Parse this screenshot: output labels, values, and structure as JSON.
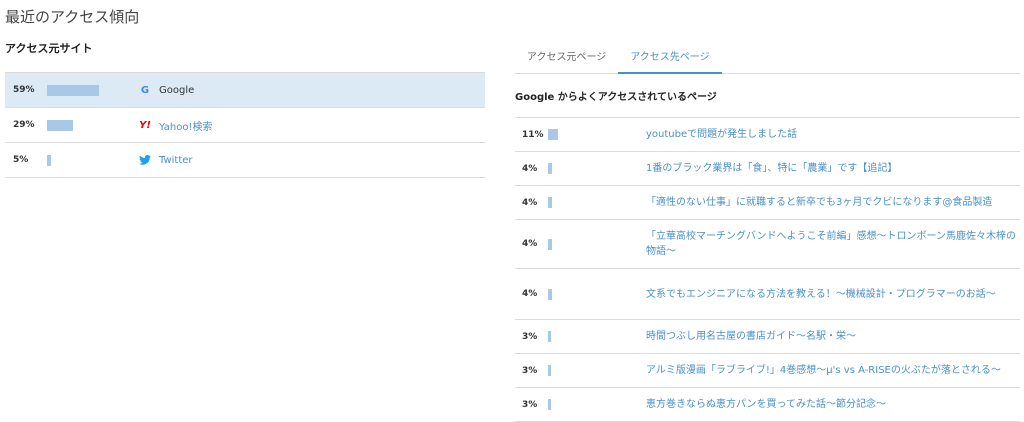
{
  "page_title": "最近のアクセス傾向",
  "sources": {
    "title": "アクセス元サイト",
    "items": [
      {
        "percent": "59%",
        "share": 0.59,
        "name": "Google",
        "icon": "google-icon",
        "selected": true
      },
      {
        "percent": "29%",
        "share": 0.29,
        "name": "Yahoo!検索",
        "icon": "yahoo-icon",
        "selected": false
      },
      {
        "percent": "5%",
        "share": 0.05,
        "name": "Twitter",
        "icon": "twitter-icon",
        "selected": false
      }
    ]
  },
  "tabs": [
    {
      "label": "アクセス元ページ",
      "active": false
    },
    {
      "label": "アクセス先ページ",
      "active": true
    }
  ],
  "destinations": {
    "title": "Google からよくアクセスされているページ",
    "items": [
      {
        "percent": "11%",
        "share": 0.11,
        "title": "youtubeで問題が発生しました話"
      },
      {
        "percent": "4%",
        "share": 0.04,
        "title": "1番のブラック業界は「食」、特に「農業」です【追記】"
      },
      {
        "percent": "4%",
        "share": 0.04,
        "title": "「適性のない仕事」に就職すると新卒でも3ヶ月でクビになります@食品製造"
      },
      {
        "percent": "4%",
        "share": 0.04,
        "title": "「立華高校マーチングバンドへようこそ前編」感想～トロンボーン馬鹿佐々木梓の物語～"
      },
      {
        "percent": "4%",
        "share": 0.04,
        "title": "文系でもエンジニアになる方法を教える！～機械設計・プログラマーのお話～"
      },
      {
        "percent": "3%",
        "share": 0.03,
        "title": "時間つぶし用名古屋の書店ガイド～名駅・栄～"
      },
      {
        "percent": "3%",
        "share": 0.03,
        "title": "アルミ版漫画「ラブライブ!」4巻感想～μ's vs A-RISEの火ぶたが落とされる～"
      },
      {
        "percent": "3%",
        "share": 0.03,
        "title": "恵方巻きならぬ恵方パンを買ってみた話～節分記念～"
      }
    ]
  },
  "colors": {
    "bar": "#a9c8e8",
    "link": "#4a90c8",
    "selected_row": "#dceaf6"
  }
}
